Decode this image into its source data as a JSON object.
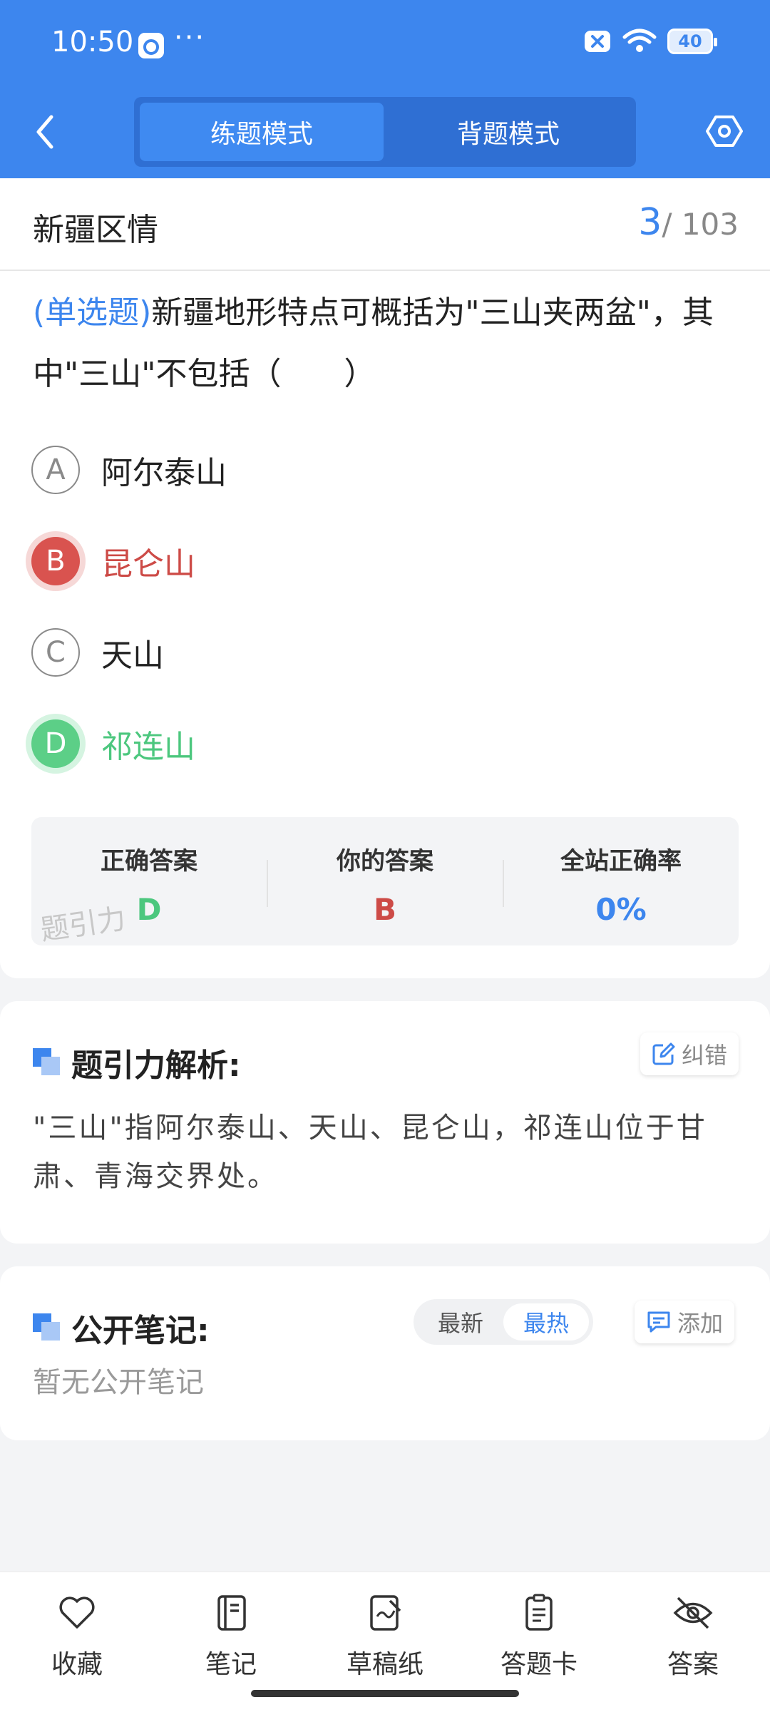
{
  "status_bar": {
    "time": "10:50",
    "dots": "···",
    "battery": "40"
  },
  "header": {
    "mode_practice": "练题模式",
    "mode_memorize": "背题模式"
  },
  "subject": {
    "title": "新疆区情",
    "current": "3",
    "total": "/ 103"
  },
  "question": {
    "type_label": "(单选题)",
    "text": "新疆地形特点可概括为\"三山夹两盆\"，其中\"三山\"不包括（　　）",
    "options": [
      {
        "letter": "A",
        "text": "阿尔泰山"
      },
      {
        "letter": "B",
        "text": "昆仑山"
      },
      {
        "letter": "C",
        "text": "天山"
      },
      {
        "letter": "D",
        "text": "祁连山"
      }
    ]
  },
  "answer_box": {
    "correct_label": "正确答案",
    "correct_value": "D",
    "yours_label": "你的答案",
    "yours_value": "B",
    "rate_label": "全站正确率",
    "rate_value": "0%",
    "watermark": "题引力"
  },
  "analysis": {
    "title": "题引力解析:",
    "report_label": "纠错",
    "text": "\"三山\"指阿尔泰山、天山、昆仑山，祁连山位于甘肃、青海交界处。"
  },
  "notes": {
    "title": "公开笔记:",
    "sort_latest": "最新",
    "sort_hot": "最热",
    "add_label": "添加",
    "empty": "暂无公开笔记"
  },
  "tabbar": {
    "favorite": "收藏",
    "note": "笔记",
    "draft": "草稿纸",
    "answer_card": "答题卡",
    "answer": "答案"
  },
  "colors": {
    "primary": "#3d86ee",
    "wrong": "#d9534f",
    "right": "#5ccf87"
  }
}
